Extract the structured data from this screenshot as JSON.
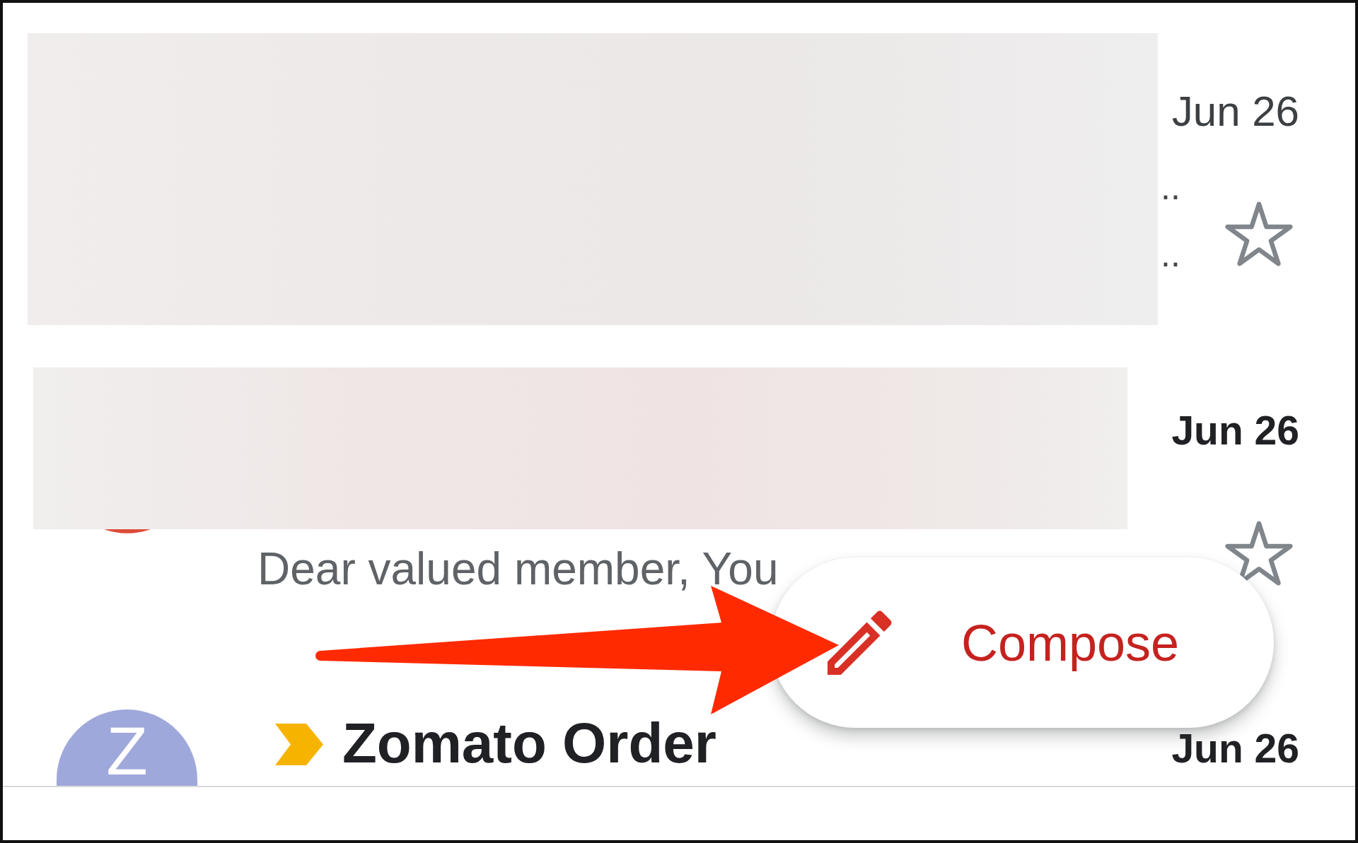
{
  "messages": [
    {
      "redacted": true,
      "unread": false,
      "date": "Jun 26",
      "line_tails": [
        "..",
        ".."
      ],
      "starred": false
    },
    {
      "redacted": true,
      "unread": true,
      "avatar": {
        "color": "#dd4b39"
      },
      "date": "Jun 26",
      "snippet": "Dear valued member, You",
      "starred": false
    },
    {
      "redacted": false,
      "unread": true,
      "avatar": {
        "letter": "Z",
        "color": "#9fa8da"
      },
      "important": true,
      "sender": "Zomato Order",
      "date": "Jun 26"
    }
  ],
  "compose_button": {
    "label": "Compose"
  },
  "annotation": {
    "kind": "arrow"
  }
}
